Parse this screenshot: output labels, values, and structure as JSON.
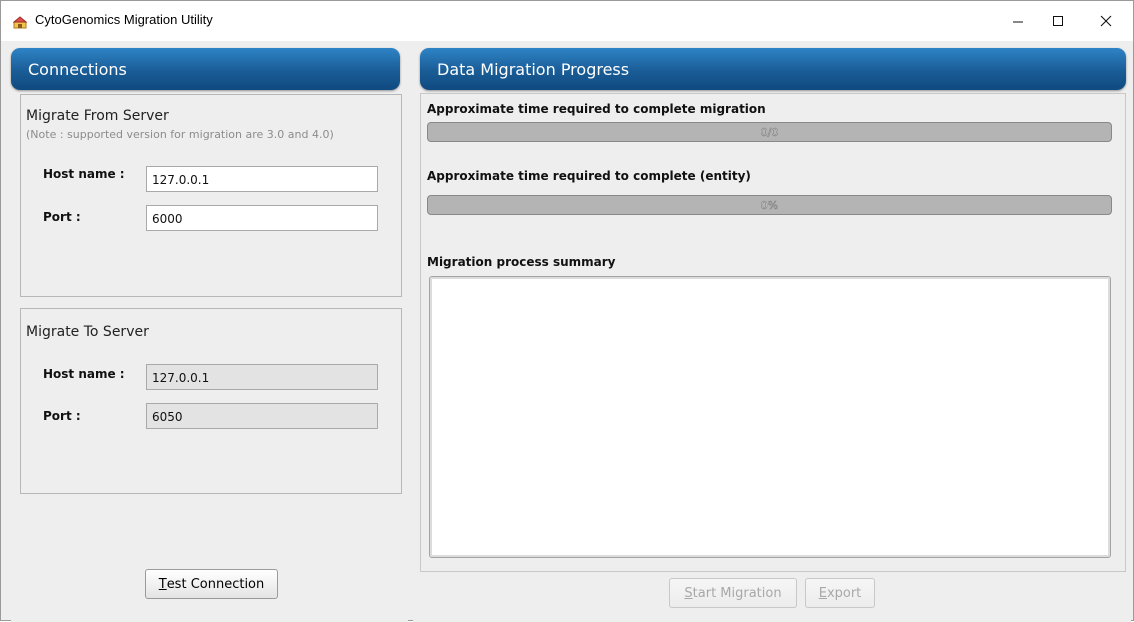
{
  "window": {
    "title": "CytoGenomics Migration Utility",
    "icons": [
      "app-icon",
      "minimize-icon",
      "maximize-icon",
      "close-icon"
    ]
  },
  "connections": {
    "header": "Connections",
    "from": {
      "title": "Migrate From Server",
      "note": "(Note : supported version for migration are 3.0 and 4.0)",
      "host_label": "Host name :",
      "host_value": "127.0.0.1",
      "port_label": "Port :",
      "port_value": "6000"
    },
    "to": {
      "title": "Migrate To Server",
      "host_label": "Host name :",
      "host_value": "127.0.0.1",
      "port_label": "Port :",
      "port_value": "6050"
    },
    "test_button": "Test Connection"
  },
  "progress": {
    "header": "Data Migration Progress",
    "migration_label": "Approximate time required to complete migration",
    "migration_text": "0/0",
    "migration_fraction": 0,
    "entity_label": "Approximate time required to complete (entity)",
    "entity_text": "0%",
    "entity_fraction": 0,
    "summary_label": "Migration process summary",
    "summary_text": "",
    "start_button": "Start Migration",
    "export_button": "Export"
  },
  "colors": {
    "header_gradient_top": "#2e84c6",
    "header_gradient_bottom": "#0f4a80",
    "progress_track": "#b4b4b4"
  }
}
